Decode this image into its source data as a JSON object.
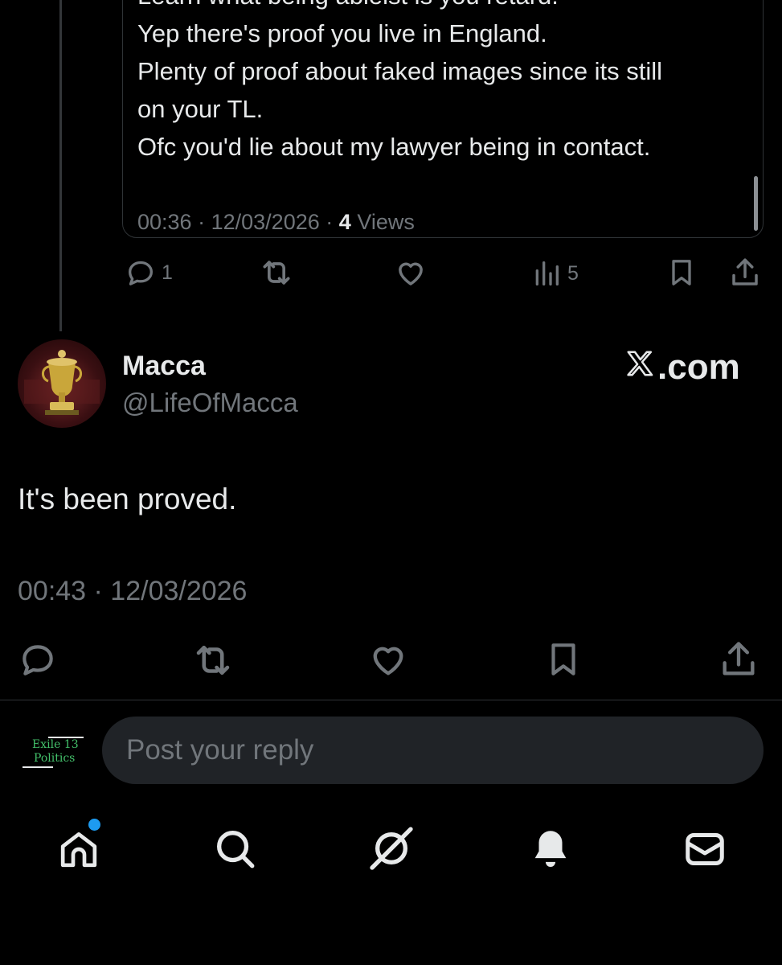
{
  "quoted_post": {
    "lines": [
      "Learn what being ableist is you retard.",
      "Yep there's proof you live in England.",
      "Plenty of proof about faked images since its still",
      "on your TL.",
      "Ofc you'd lie about my lawyer being in contact."
    ],
    "time": "00:36",
    "date": "12/03/2026",
    "views_count": "4",
    "views_label": "Views",
    "separator": "·",
    "actions": {
      "reply_count": "1",
      "views_count": "5"
    }
  },
  "post": {
    "author_name": "Macca",
    "author_handle": "@LifeOfMacca",
    "text": "It's been proved.",
    "timestamp": "00:43 · 12/03/2026"
  },
  "watermark": {
    "text": ".com"
  },
  "reply_bar": {
    "avatar_line1": "Exile 13",
    "avatar_line2": "Politics",
    "placeholder": "Post your reply"
  },
  "colors": {
    "background": "#000000",
    "text_primary": "#e7e9ea",
    "text_secondary": "#71767b",
    "accent": "#1d9bf0",
    "input_bg": "#202327"
  },
  "icons": {
    "quoted_actions": [
      "reply-icon",
      "repost-icon",
      "like-icon",
      "views-icon",
      "bookmark-icon",
      "share-icon"
    ],
    "post_actions": [
      "reply-icon",
      "repost-icon",
      "like-icon",
      "bookmark-icon",
      "share-icon"
    ],
    "bottom_nav": [
      "home-icon",
      "search-icon",
      "grok-icon",
      "notifications-icon",
      "messages-icon"
    ]
  }
}
